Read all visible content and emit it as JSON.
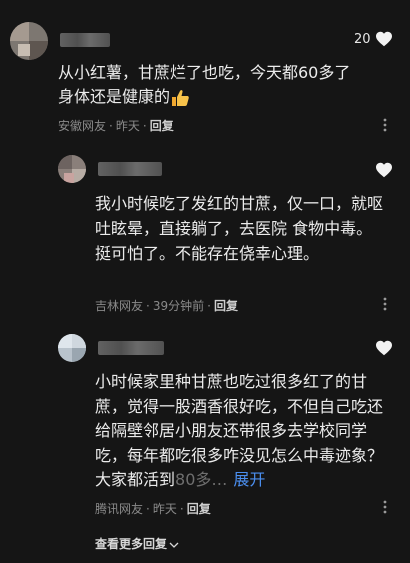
{
  "comments": [
    {
      "likes": "20",
      "text": "从小红薯，甘蔗烂了也吃，今天都60多了身体还是健康的",
      "location": "安徽网友",
      "time": "昨天",
      "reply_label": "回复",
      "emoji": "thumbs-up-icon"
    },
    {
      "text": "我小时候吃了发红的甘蔗，仅一口，就呕吐眩晕，直接躺了，去医院 食物中毒。挺可怕了。不能存在侥幸心理。",
      "location": "吉林网友",
      "time": "39分钟前",
      "reply_label": "回复"
    },
    {
      "text_main": "小时候家里种甘蔗也吃过很多红了的甘蔗，觉得一股酒香很好吃，不但自己吃还给隔壁邻居小朋友还带很多去学校同学吃，每年都吃很多咋没见怎么中毒迹象？大家都活到",
      "text_faded": "80多…",
      "expand_label": "展开",
      "location": "腾讯网友",
      "time": "昨天",
      "reply_label": "回复"
    }
  ],
  "view_more_label": "查看更多回复",
  "colors": {
    "background": "#151515",
    "link": "#4b8ff0",
    "meta": "#8a8a8a"
  }
}
